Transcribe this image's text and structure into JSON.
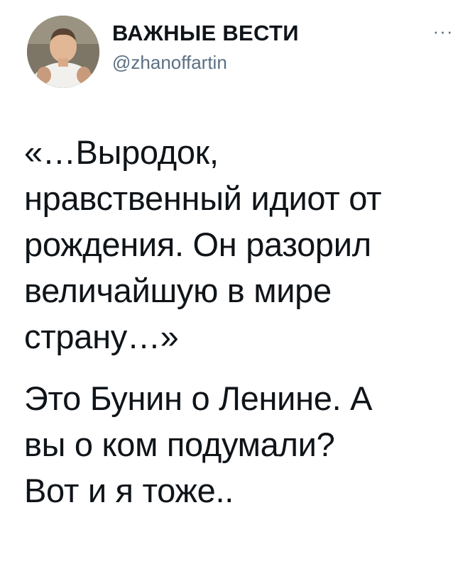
{
  "tweet": {
    "author": {
      "display_name": "ВАЖНЫЕ ВЕСТИ",
      "handle": "@zhanoffartin",
      "avatar_icon": "profile-photo"
    },
    "more_icon_label": "···",
    "paragraphs": [
      {
        "lines": [
          "«…Выродок,",
          "нравственный идиот от",
          "рождения. Он разорил",
          "величайшую в мире",
          "страну…»"
        ]
      },
      {
        "lines": [
          "Это Бунин о Ленине. А",
          "вы о ком подумали?",
          "Вот и я тоже.."
        ]
      }
    ]
  },
  "colors": {
    "background": "#ffffff",
    "text": "#0f1419",
    "secondary_text": "#5b7083"
  }
}
